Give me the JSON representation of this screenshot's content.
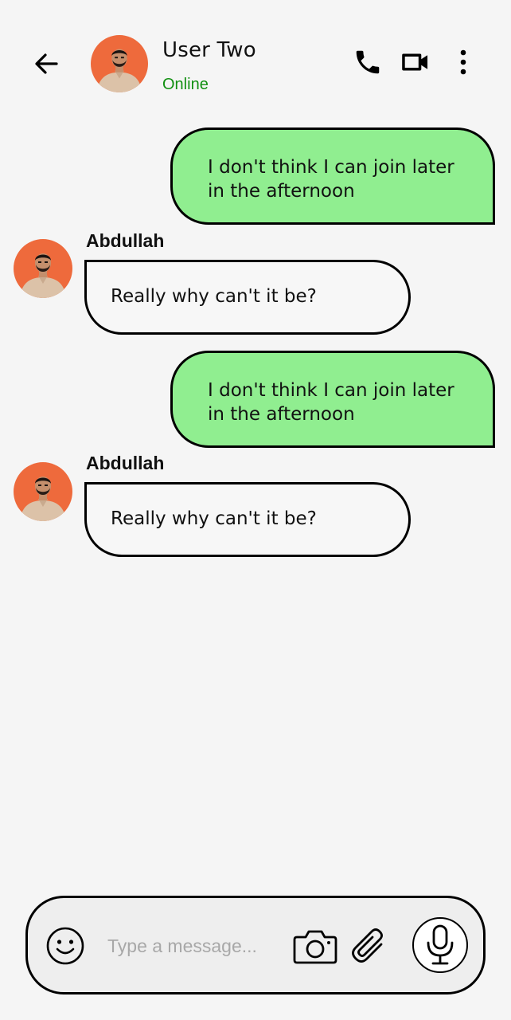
{
  "header": {
    "contact_name": "User Two",
    "status": "Online",
    "status_color": "#129012",
    "icons": {
      "back": "arrow-left-icon",
      "call": "phone-icon",
      "video": "video-camera-icon",
      "menu": "more-vertical-icon"
    }
  },
  "colors": {
    "background": "#f5f5f5",
    "outgoing_bubble": "#90ee90",
    "incoming_bubble": "#f7f7f7",
    "avatar_bg": "#ee6a3c"
  },
  "messages": [
    {
      "direction": "outgoing",
      "text": "I don't think I can join later in the afternoon"
    },
    {
      "direction": "incoming",
      "sender": "Abdullah",
      "text": "Really why can't it be?"
    },
    {
      "direction": "outgoing",
      "text": "I don't think I can join later in the afternoon"
    },
    {
      "direction": "incoming",
      "sender": "Abdullah",
      "text": "Really why can't it be?"
    }
  ],
  "composer": {
    "placeholder": "Type a message...",
    "value": "",
    "icons": {
      "emoji": "smiley-icon",
      "camera": "camera-icon",
      "attach": "paperclip-icon",
      "mic": "microphone-icon"
    }
  }
}
